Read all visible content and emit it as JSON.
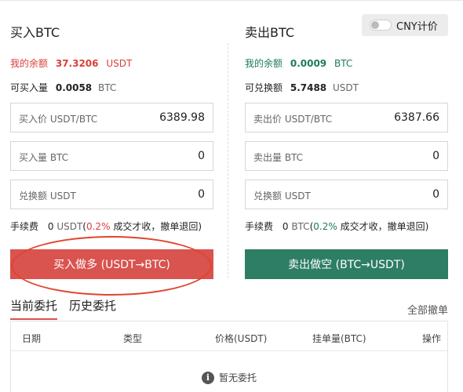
{
  "buy": {
    "title": "买入BTC",
    "balance": {
      "label": "我的余额",
      "value": "37.3206",
      "unit": "USDT"
    },
    "available": {
      "label": "可买入量",
      "value": "0.0058",
      "unit": "BTC"
    },
    "fields": [
      {
        "label": "买入价 USDT/BTC",
        "value": "6389.98"
      },
      {
        "label": "买入量 BTC",
        "value": "0"
      },
      {
        "label": "兑换额 USDT",
        "value": "0"
      }
    ],
    "fee": {
      "label": "手续费",
      "value": "0",
      "unit": "USDT",
      "open": "(",
      "pct": "0.2%",
      "note": "成交才收，撤单退回)"
    },
    "button": "买入做多 (USDT→BTC)",
    "accent": "#d9534f"
  },
  "sell": {
    "title": "卖出BTC",
    "balance": {
      "label": "我的余额",
      "value": "0.0009",
      "unit": "BTC"
    },
    "available": {
      "label": "可兑换额",
      "value": "5.7488",
      "unit": "USDT"
    },
    "fields": [
      {
        "label": "卖出价 USDT/BTC",
        "value": "6387.66"
      },
      {
        "label": "卖出量 BTC",
        "value": "0"
      },
      {
        "label": "兑换额 USDT",
        "value": "0"
      }
    ],
    "fee": {
      "label": "手续费",
      "value": "0",
      "unit": "BTC",
      "open": "(",
      "pct": "0.2%",
      "note": "成交才收，撤单退回)"
    },
    "button": "卖出做空 (BTC→USDT)",
    "accent": "#2e7d65"
  },
  "currency_toggle": {
    "label": "CNY计价",
    "on": false
  },
  "orders": {
    "tabs": [
      "当前委托",
      "历史委托"
    ],
    "active_tab": 0,
    "cancel_all": "全部撤单",
    "columns": [
      "日期",
      "类型",
      "价格(USDT)",
      "挂单量(BTC)",
      "操作"
    ],
    "empty_icon": "info-icon",
    "empty_text": "暂无委托"
  }
}
